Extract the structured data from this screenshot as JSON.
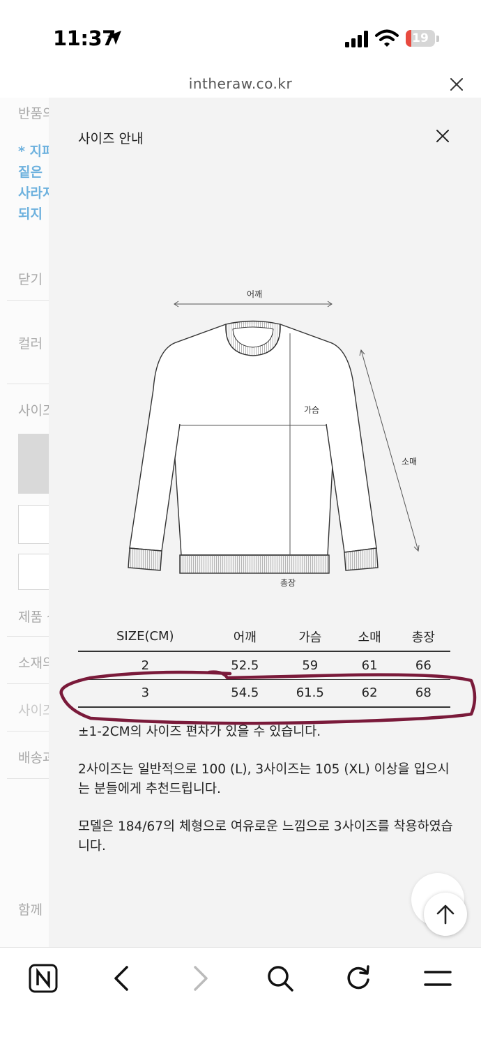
{
  "status_bar": {
    "time": "11:37",
    "battery_level": "19",
    "battery_fraction": 0.19,
    "icons": [
      "location-arrow-icon",
      "signal-icon",
      "wifi-icon",
      "battery-icon"
    ]
  },
  "browser": {
    "url": "intheraw.co.kr"
  },
  "background_page": {
    "items": [
      "반품의",
      "닫기",
      "컬러",
      "사이즈",
      "제품 상",
      "소재의",
      "사이즈",
      "배송과",
      "함께"
    ],
    "notice_lines": [
      "* 지퍼",
      "짙은",
      "사라지",
      "되지"
    ]
  },
  "modal": {
    "title": "사이즈 안내",
    "diagram_labels": {
      "shoulder": "어깨",
      "chest": "가슴",
      "sleeve": "소매",
      "length": "총장"
    },
    "table": {
      "headers": [
        "SIZE(CM)",
        "어깨",
        "가슴",
        "소매",
        "총장"
      ],
      "rows": [
        [
          "2",
          "52.5",
          "59",
          "61",
          "66"
        ],
        [
          "3",
          "54.5",
          "61.5",
          "62",
          "68"
        ]
      ]
    },
    "notes": [
      "±1-2CM의 사이즈 편차가 있을 수 있습니다.",
      "2사이즈는 일반적으로 100 (L), 3사이즈는 105 (XL) 이상을 입으시는 분들에게 추천드립니다.",
      "모델은 184/67의 체형으로 여유로운 느낌으로 3사이즈를 착용하였습니다."
    ]
  },
  "colors": {
    "annotation_stroke": "#7a1a3a",
    "notice_blue": "#6db1de",
    "battery_red": "#e84a3f"
  },
  "toolbar": {
    "icons": [
      "naver-n-icon",
      "back-arrow-icon",
      "forward-arrow-icon",
      "search-icon",
      "refresh-icon",
      "menu-icon"
    ]
  }
}
